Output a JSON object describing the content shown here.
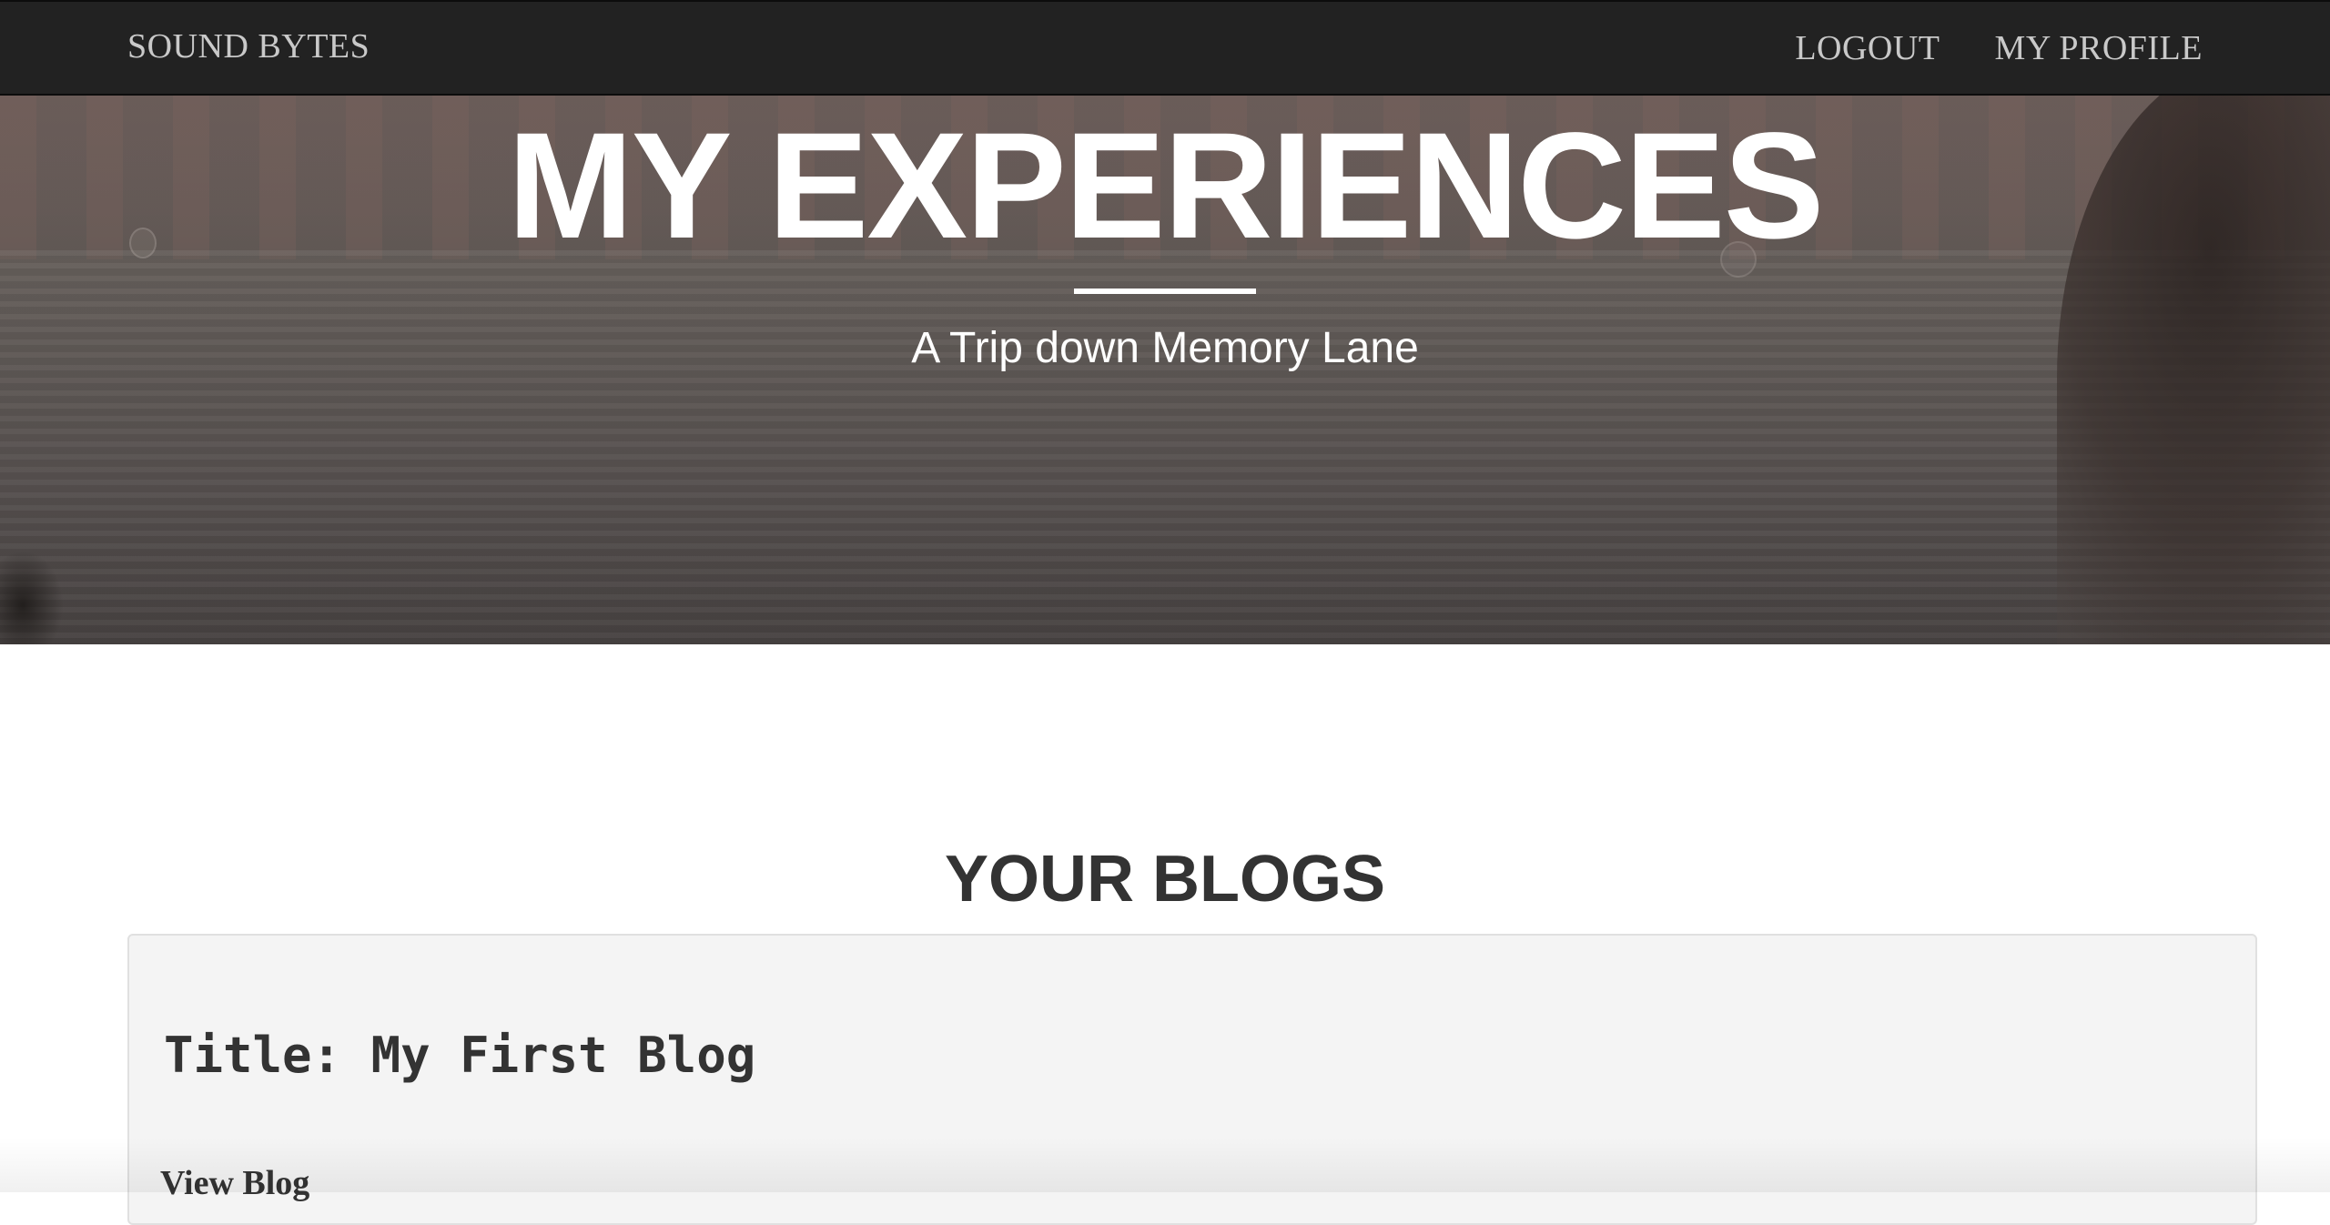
{
  "navbar": {
    "brand": "SOUND BYTES",
    "links": [
      {
        "label": "LOGOUT"
      },
      {
        "label": "MY PROFILE"
      }
    ]
  },
  "hero": {
    "title": "MY EXPERIENCES",
    "subtitle": "A Trip down Memory Lane"
  },
  "blogs": {
    "heading": "YOUR BLOGS",
    "items": [
      {
        "title": "Title: My First Blog",
        "link_label": "View Blog"
      }
    ]
  }
}
